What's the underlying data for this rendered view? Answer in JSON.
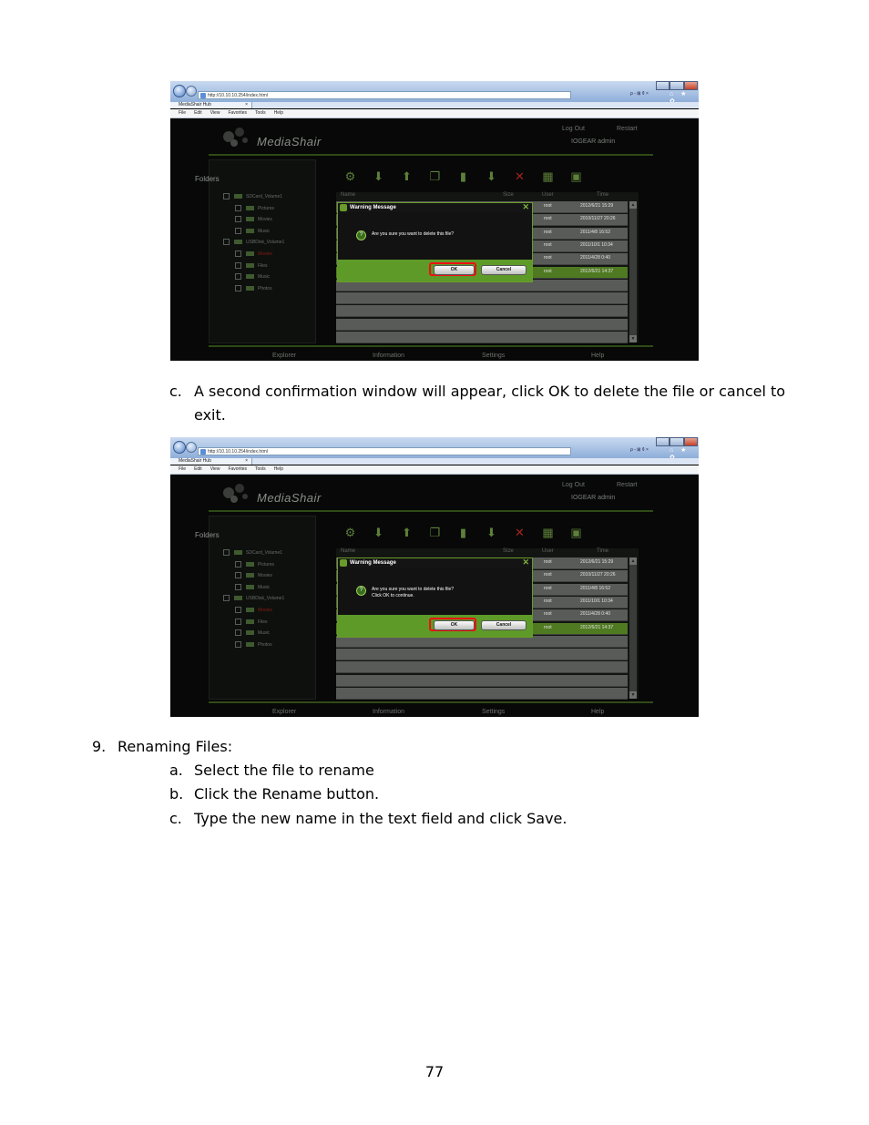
{
  "screenshots": [
    {
      "browser": {
        "address": "http://10.10.10.254/index.html",
        "tab_title": "MediaShair Hub",
        "tab_close": "×",
        "address_tools": "ρ - ⊠ ¢ ×",
        "right_icons": "⌂ ★ ✿",
        "menu": [
          "File",
          "Edit",
          "View",
          "Favorites",
          "Tools",
          "Help"
        ]
      },
      "app": {
        "logo": "MediaShair",
        "logout": "Log Out",
        "restart": "Restart",
        "user_line": "IOGEAR   admin",
        "folders_title": "Folders",
        "folders": [
          {
            "label": "SDCard_Volume1",
            "level": 0
          },
          {
            "label": "Pictures",
            "level": 1
          },
          {
            "label": "Movies",
            "level": 1
          },
          {
            "label": "Music",
            "level": 1
          },
          {
            "label": "USBDisk_Volume1",
            "level": 0
          },
          {
            "label": "Movies",
            "level": 1,
            "active": true
          },
          {
            "label": "Files",
            "level": 1
          },
          {
            "label": "Music",
            "level": 1
          },
          {
            "label": "Photos",
            "level": 1
          }
        ],
        "table_headers": {
          "name": "Name",
          "size": "Size",
          "user": "User",
          "time": "Time"
        },
        "rows": [
          {
            "user": "root",
            "time": "2012/6/21 15:29"
          },
          {
            "user": "root",
            "time": "2010/11/27 20:26"
          },
          {
            "user": "root",
            "time": "2011/4/8 16:52"
          },
          {
            "user": "root",
            "time": "2011/10/1 10:34"
          },
          {
            "user": "root",
            "time": "2011/4/28 0:40"
          },
          {
            "user": "root",
            "time": "2012/6/21 14:37",
            "selected": true
          }
        ],
        "nav": [
          "Explorer",
          "Information",
          "Settings",
          "Help"
        ]
      },
      "dialog": {
        "title": "Warning Message",
        "close": "✕",
        "message_line1": "Are you sure you want to delete this file?",
        "message_line2": "",
        "ok": "OK",
        "cancel": "Cancel"
      }
    },
    {
      "browser": {
        "address": "http://10.10.10.254/index.html",
        "tab_title": "MediaShair Hub",
        "tab_close": "×",
        "address_tools": "ρ - ⊠ ¢ ×",
        "right_icons": "⌂ ★ ✿",
        "menu": [
          "File",
          "Edit",
          "View",
          "Favorites",
          "Tools",
          "Help"
        ]
      },
      "app": {
        "logo": "MediaShair",
        "logout": "Log Out",
        "restart": "Restart",
        "user_line": "IOGEAR   admin",
        "folders_title": "Folders",
        "folders": [
          {
            "label": "SDCard_Volume1",
            "level": 0
          },
          {
            "label": "Pictures",
            "level": 1
          },
          {
            "label": "Movies",
            "level": 1
          },
          {
            "label": "Music",
            "level": 1
          },
          {
            "label": "USBDisk_Volume1",
            "level": 0
          },
          {
            "label": "Movies",
            "level": 1,
            "active": true
          },
          {
            "label": "Files",
            "level": 1
          },
          {
            "label": "Music",
            "level": 1
          },
          {
            "label": "Photos",
            "level": 1
          }
        ],
        "table_headers": {
          "name": "Name",
          "size": "Size",
          "user": "User",
          "time": "Time"
        },
        "rows": [
          {
            "user": "root",
            "time": "2012/6/21 15:29"
          },
          {
            "user": "root",
            "time": "2010/11/27 20:26"
          },
          {
            "user": "root",
            "time": "2011/4/8 16:52"
          },
          {
            "user": "root",
            "time": "2011/10/1 10:34"
          },
          {
            "user": "root",
            "time": "2011/4/28 0:40"
          },
          {
            "user": "root",
            "time": "2012/6/21 14:37",
            "selected": true
          }
        ],
        "nav": [
          "Explorer",
          "Information",
          "Settings",
          "Help"
        ]
      },
      "dialog": {
        "title": "Warning Message",
        "close": "✕",
        "message_line1": "Are you sure you want to delete this file?",
        "message_line2": "Click OK to continue.",
        "ok": "OK",
        "cancel": "Cancel"
      }
    }
  ],
  "text": {
    "item_c1_marker": "c.",
    "item_c1_line1": "A second confirmation window will appear, click OK to delete the file or cancel to",
    "item_c1_line2": "exit.",
    "step9_marker": "9.",
    "step9_title": "Renaming Files:",
    "sub_a_marker": "a.",
    "sub_a": "Select the file to rename",
    "sub_b_marker": "b.",
    "sub_b": "Click the Rename button.",
    "sub_c_marker": "c.",
    "sub_c": "Type the new name in the text field and click Save."
  },
  "page_number": "77"
}
